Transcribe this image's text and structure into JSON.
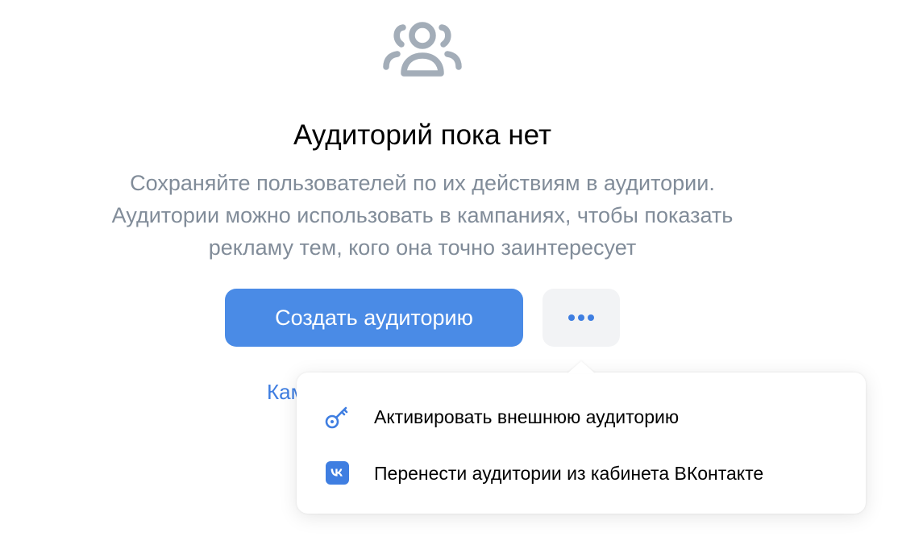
{
  "empty_state": {
    "icon": "users-icon",
    "title": "Аудиторий пока нет",
    "description_lines": [
      "Сохраняйте пользователей по их действиям в аудитории.",
      "Аудитории можно использовать в кампаниях, чтобы показать",
      "рекламу тем, кого она точно заинтересует"
    ],
    "create_button_label": "Создать аудиторию",
    "more_button_icon": "more-dots-icon",
    "partial_link_text": "Кам"
  },
  "dropdown": {
    "items": [
      {
        "icon": "key-icon",
        "label": "Активировать внешнюю аудиторию"
      },
      {
        "icon": "vk-logo-icon",
        "label": "Перенести аудитории из кабинета ВКонтакте"
      }
    ]
  },
  "colors": {
    "accent": "#4a8be6",
    "link": "#3f7ee1",
    "secondary_text": "#818c99",
    "icon_gray": "#a3adb8",
    "more_button_bg": "#f2f3f5"
  }
}
